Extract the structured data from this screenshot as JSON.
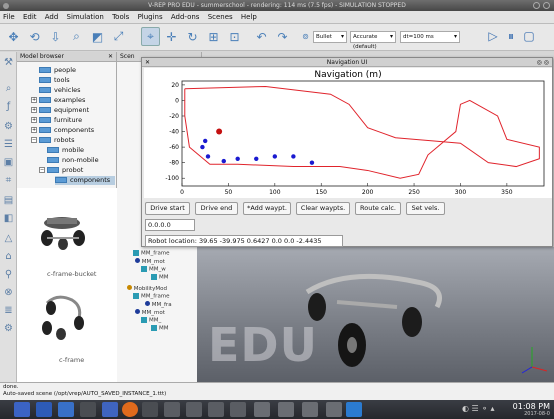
{
  "window": {
    "title": "V-REP PRO EDU - summerschool - rendering: 114 ms (7.5 fps) - SIMULATION STOPPED"
  },
  "menu": [
    "File",
    "Edit",
    "Add",
    "Simulation",
    "Tools",
    "Plugins",
    "Add-ons",
    "Scenes",
    "Help"
  ],
  "toolbar": {
    "engine": "Bullet",
    "accuracy": "Accurate (default)",
    "dt": "dt=100 ms"
  },
  "model_browser": {
    "title": "Model browser",
    "items": [
      "people",
      "tools",
      "vehicles",
      "examples",
      "equipment",
      "furniture",
      "components",
      "robots",
      "mobile",
      "non-mobile",
      "probot",
      "components"
    ],
    "thumbnails": [
      "c-frame-bucket",
      "c-frame"
    ]
  },
  "scene_hierarchy": {
    "title": "Scene hierarchy",
    "items": [
      "MM_frame",
      "MM_mot",
      "MM_w",
      "MM",
      "MobilityMod",
      "MM_frame",
      "MM_fra",
      "MM_mot",
      "MM_",
      "MM"
    ]
  },
  "nav": {
    "title": "Navigation UI",
    "plot_title": "Navigation (m)",
    "buttons": [
      "Drive start",
      "Drive end",
      "*Add waypt.",
      "Clear waypts.",
      "Route calc.",
      "Set vels."
    ],
    "field_value": "0.0.0.0",
    "robot_location": "Robot location: 39.65 -39.975 0.6427 0.0 0.0 -2.4435"
  },
  "chart_data": {
    "type": "scatter",
    "title": "Navigation (m)",
    "xlim": [
      0,
      390
    ],
    "ylim": [
      -110,
      25
    ],
    "xticks": [
      0,
      50,
      100,
      150,
      200,
      250,
      300,
      350
    ],
    "yticks": [
      20,
      0,
      -20,
      -40,
      -60,
      -80,
      -100
    ],
    "series": [
      {
        "role": "boundary",
        "color": "#e0242c",
        "polygons": [
          [
            [
              3,
              15
            ],
            [
              90,
              18
            ],
            [
              160,
              8
            ],
            [
              180,
              -5
            ],
            [
              200,
              -35
            ],
            [
              230,
              -48
            ],
            [
              270,
              -52
            ],
            [
              300,
              -55
            ],
            [
              330,
              -80
            ],
            [
              360,
              -85
            ],
            [
              385,
              -75
            ],
            [
              385,
              -60
            ],
            [
              350,
              -50
            ],
            [
              340,
              -20
            ],
            [
              310,
              0
            ],
            [
              300,
              -5
            ],
            [
              295,
              -40
            ],
            [
              265,
              -70
            ],
            [
              255,
              -95
            ],
            [
              235,
              -100
            ],
            [
              200,
              -90
            ],
            [
              170,
              -85
            ],
            [
              120,
              -85
            ],
            [
              60,
              -82
            ],
            [
              30,
              -82
            ],
            [
              8,
              -60
            ],
            [
              3,
              -20
            ],
            [
              3,
              15
            ]
          ]
        ]
      },
      {
        "role": "waypoints",
        "color": "#1a1ad0",
        "points": [
          [
            25,
            -52
          ],
          [
            22,
            -60
          ],
          [
            28,
            -72
          ],
          [
            45,
            -78
          ],
          [
            60,
            -75
          ],
          [
            80,
            -75
          ],
          [
            100,
            -72
          ],
          [
            120,
            -72
          ],
          [
            140,
            -80
          ]
        ]
      },
      {
        "role": "robot",
        "color": "#c41010",
        "points": [
          [
            40,
            -40
          ]
        ]
      }
    ]
  },
  "status": {
    "line1": "done.",
    "line2": "Auto-saved scene (/opt/vrep/AUTO_SAVED_INSTANCE_1.ttt)"
  },
  "watermark": "EDU",
  "taskbar": {
    "time": "01:08 PM",
    "date": "2017-08-0"
  }
}
